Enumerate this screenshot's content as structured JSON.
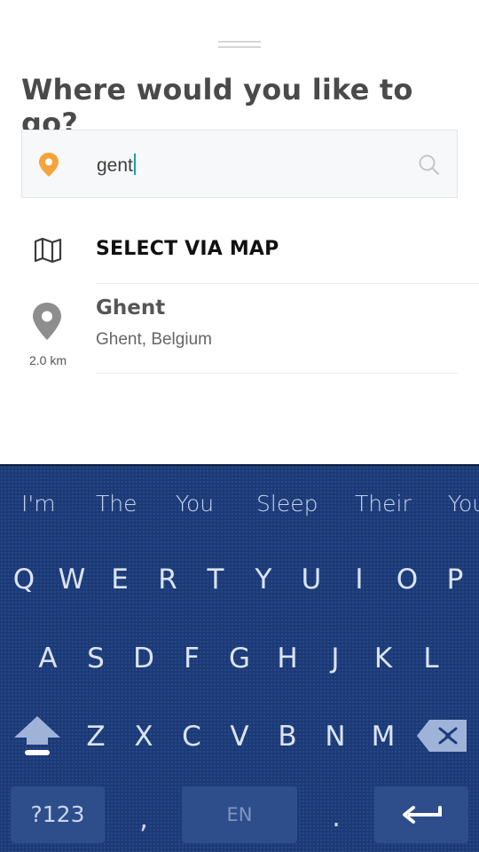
{
  "sheet": {
    "title": "Where would you like to go?",
    "search": {
      "value": "gent",
      "icons": [
        "location-pin-icon",
        "search-icon"
      ]
    },
    "select_via_map": "SELECT VIA MAP",
    "results": [
      {
        "name": "Ghent",
        "subtitle": "Ghent, Belgium",
        "distance": "2.0 km"
      }
    ]
  },
  "keyboard": {
    "suggestions": [
      "I'm",
      "The",
      "You",
      "Sleep",
      "Their",
      "You"
    ],
    "row1": [
      "Q",
      "W",
      "E",
      "R",
      "T",
      "Y",
      "U",
      "I",
      "O",
      "P"
    ],
    "row2": [
      "A",
      "S",
      "D",
      "F",
      "G",
      "H",
      "J",
      "K",
      "L"
    ],
    "row3": [
      "Z",
      "X",
      "C",
      "V",
      "B",
      "N",
      "M"
    ],
    "symbols_label": "?123",
    "comma": ",",
    "space_label": "EN",
    "period": ".",
    "colors": {
      "background": "#1b3a78",
      "key_fill": "#2d4d8b",
      "accent_pin": "#f7a23b"
    }
  }
}
